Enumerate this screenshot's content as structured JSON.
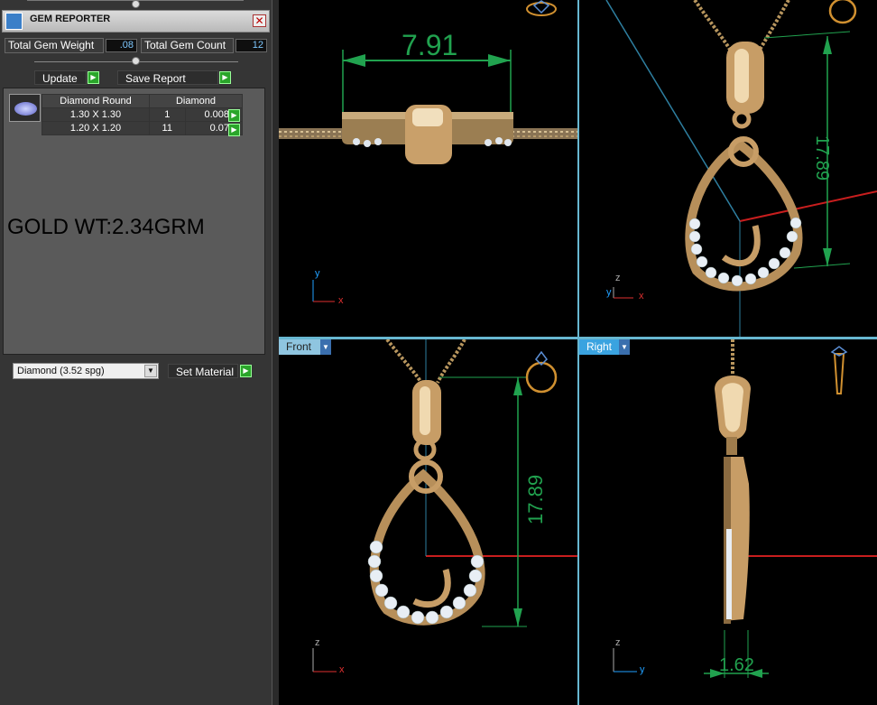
{
  "panel": {
    "title": "GEM REPORTER",
    "close_glyph": "✕",
    "total_weight_label": "Total Gem Weight",
    "total_weight_value": ".08",
    "total_count_label": "Total Gem Count",
    "total_count_value": "12",
    "update_label": "Update",
    "save_report_label": "Save Report",
    "go_glyph": "▶",
    "gem_icon": "diamond-round-icon",
    "table": {
      "headers": [
        "Diamond Round",
        "Diamond"
      ],
      "rows": [
        {
          "size": "1.30 X 1.30",
          "count": "1",
          "weight": "0.008tw"
        },
        {
          "size": "1.20 X 1.20",
          "count": "11",
          "weight": "0.07tw"
        }
      ]
    },
    "gold_weight": "GOLD WT:2.34GRM",
    "material_select": "Diamond     (3.52 spg)",
    "set_material_label": "Set Material"
  },
  "viewports": {
    "top": {
      "dimension": "7.91",
      "axis_y": "y",
      "axis_x": "x"
    },
    "perspective": {
      "dimension": "17.89",
      "axis_z": "z",
      "axis_y": "y",
      "axis_x": "x"
    },
    "front": {
      "tab": "Front",
      "dimension": "17.89",
      "axis_z": "z",
      "axis_x": "x"
    },
    "right": {
      "tab": "Right",
      "dimension": "1.62",
      "axis_z": "z",
      "axis_y": "y"
    }
  },
  "colors": {
    "viewport_border": "#67b7d1",
    "dimension_green": "#21a24f",
    "gold": "#c9a06a",
    "red_axis": "#c81e1e"
  }
}
